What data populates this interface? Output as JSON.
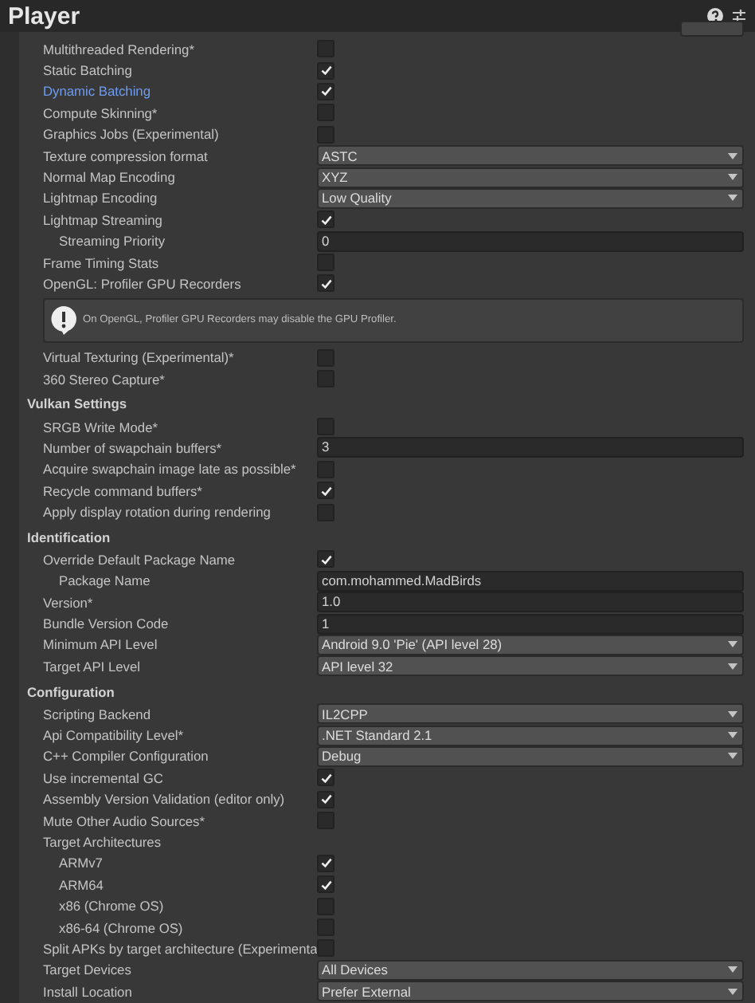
{
  "window": {
    "title": "Player"
  },
  "sections": [
    {
      "rows": [
        {
          "kind": "check",
          "label": "Multithreaded Rendering*",
          "checked": false,
          "highlighted": false
        },
        {
          "kind": "check",
          "label": "Static Batching",
          "checked": true,
          "highlighted": false
        },
        {
          "kind": "check",
          "label": "Dynamic Batching",
          "checked": true,
          "highlighted": true
        },
        {
          "kind": "check",
          "label": "Compute Skinning*",
          "checked": false,
          "highlighted": false
        },
        {
          "kind": "check",
          "label": "Graphics Jobs (Experimental)",
          "checked": false,
          "highlighted": false
        },
        {
          "kind": "dropdown",
          "label": "Texture compression format",
          "value": "ASTC",
          "highlighted": false
        },
        {
          "kind": "dropdown",
          "label": "Normal Map Encoding",
          "value": "XYZ",
          "highlighted": false
        },
        {
          "kind": "dropdown",
          "label": "Lightmap Encoding",
          "value": "Low Quality",
          "highlighted": false
        },
        {
          "kind": "check",
          "label": "Lightmap Streaming",
          "checked": true,
          "highlighted": false,
          "children": [
            {
              "kind": "field",
              "label": "Streaming Priority",
              "value": "0"
            }
          ]
        },
        {
          "kind": "check",
          "label": "Frame Timing Stats",
          "checked": false,
          "highlighted": false
        },
        {
          "kind": "check",
          "label": "OpenGL: Profiler GPU Recorders",
          "checked": true,
          "highlighted": false
        },
        {
          "kind": "info",
          "text": "On OpenGL, Profiler GPU Recorders may disable the GPU Profiler."
        },
        {
          "kind": "check",
          "label": "Virtual Texturing (Experimental)*",
          "checked": false,
          "highlighted": false
        },
        {
          "kind": "check",
          "label": "360 Stereo Capture*",
          "checked": false,
          "highlighted": false
        }
      ]
    },
    {
      "title": "Vulkan Settings",
      "rows": [
        {
          "kind": "check",
          "label": "SRGB Write Mode*",
          "checked": false
        },
        {
          "kind": "field",
          "label": "Number of swapchain buffers*",
          "value": "3"
        },
        {
          "kind": "check",
          "label": "Acquire swapchain image late as possible*",
          "checked": false
        },
        {
          "kind": "check",
          "label": "Recycle command buffers*",
          "checked": true
        },
        {
          "kind": "check",
          "label": "Apply display rotation during rendering",
          "checked": false
        }
      ]
    },
    {
      "title": "Identification",
      "rows": [
        {
          "kind": "check",
          "label": "Override Default Package Name",
          "checked": true,
          "children": [
            {
              "kind": "field",
              "label": "Package Name",
              "value": "com.mohammed.MadBirds"
            }
          ]
        },
        {
          "kind": "field",
          "label": "Version*",
          "value": "1.0"
        },
        {
          "kind": "field",
          "label": "Bundle Version Code",
          "value": "1"
        },
        {
          "kind": "dropdown",
          "label": "Minimum API Level",
          "value": "Android 9.0 'Pie' (API level 28)"
        },
        {
          "kind": "dropdown",
          "label": "Target API Level",
          "value": "API level 32"
        }
      ]
    },
    {
      "title": "Configuration",
      "rows": [
        {
          "kind": "dropdown",
          "label": "Scripting Backend",
          "value": "IL2CPP"
        },
        {
          "kind": "dropdown",
          "label": "Api Compatibility Level*",
          "value": ".NET Standard 2.1"
        },
        {
          "kind": "dropdown",
          "label": "C++ Compiler Configuration",
          "value": "Debug"
        },
        {
          "kind": "check",
          "label": "Use incremental GC",
          "checked": true
        },
        {
          "kind": "check",
          "label": "Assembly Version Validation (editor only)",
          "checked": true
        },
        {
          "kind": "check",
          "label": "Mute Other Audio Sources*",
          "checked": false
        },
        {
          "kind": "label",
          "label": "Target Architectures",
          "children": [
            {
              "kind": "check",
              "label": "ARMv7",
              "checked": true
            },
            {
              "kind": "check",
              "label": "ARM64",
              "checked": true
            },
            {
              "kind": "check",
              "label": "x86 (Chrome OS)",
              "checked": false
            },
            {
              "kind": "check",
              "label": "x86-64 (Chrome OS)",
              "checked": false
            }
          ]
        },
        {
          "kind": "check",
          "label": "Split APKs by target architecture (Experimenta",
          "checked": false
        },
        {
          "kind": "dropdown",
          "label": "Target Devices",
          "value": "All Devices"
        },
        {
          "kind": "dropdown",
          "label": "Install Location",
          "value": "Prefer External"
        }
      ]
    }
  ]
}
